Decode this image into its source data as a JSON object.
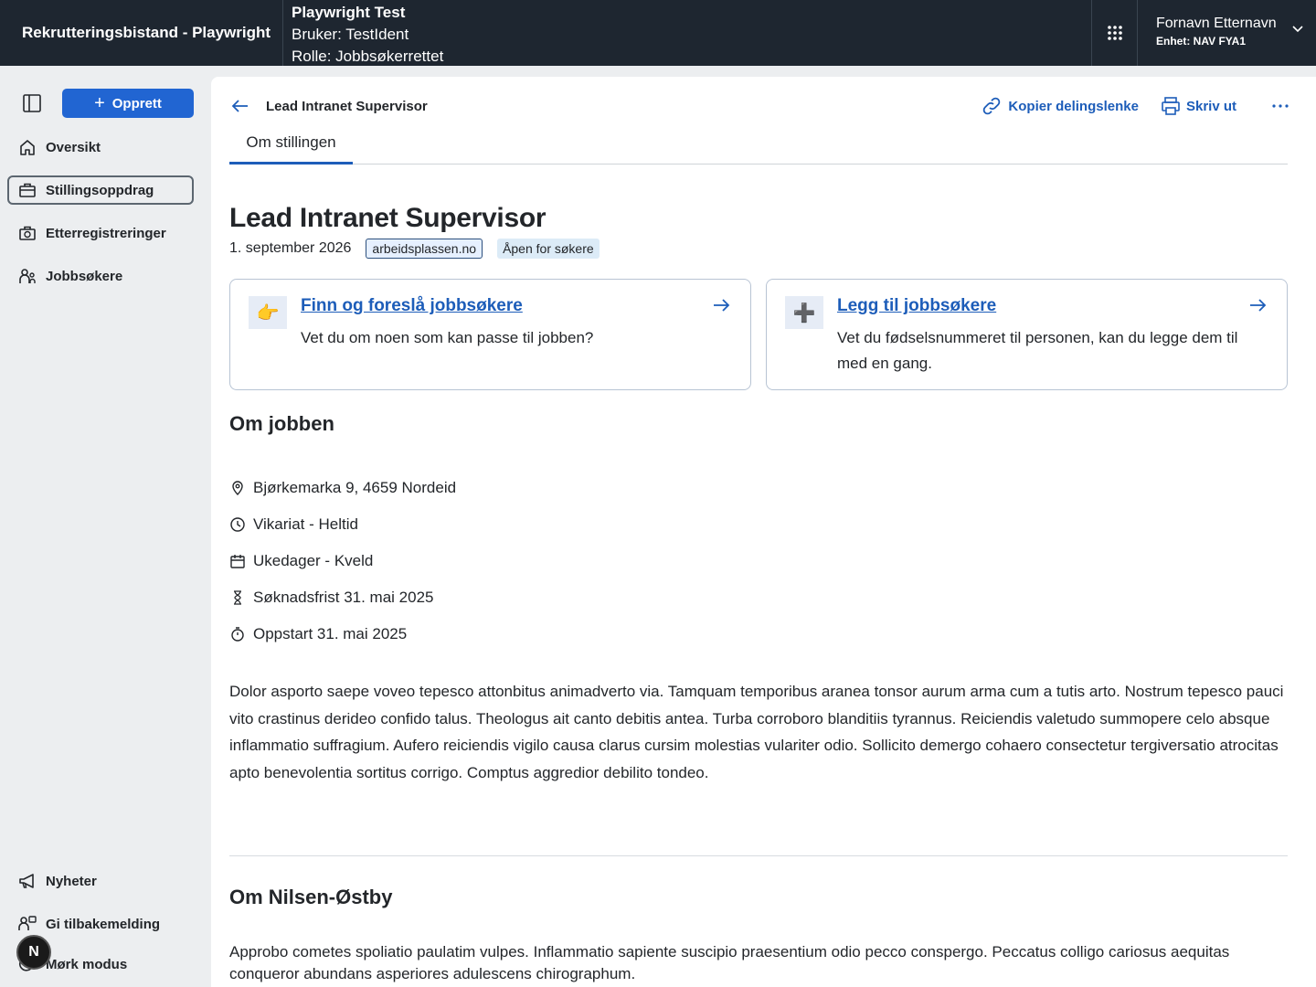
{
  "header": {
    "app_title": "Rekrutteringsbistand - Playwright",
    "env_name": "Playwright Test",
    "env_user": "Bruker: TestIdent",
    "env_role": "Rolle: Jobbsøkerrettet",
    "user_name": "Fornavn Etternavn",
    "user_unit": "Enhet: NAV FYA1"
  },
  "sidebar": {
    "create_label": "Opprett",
    "items": [
      {
        "label": "Oversikt",
        "icon": "house-icon"
      },
      {
        "label": "Stillingsoppdrag",
        "icon": "briefcase-icon",
        "active": true
      },
      {
        "label": "Etterregistreringer",
        "icon": "briefcase-clock-icon"
      },
      {
        "label": "Jobbsøkere",
        "icon": "person-group-icon"
      }
    ],
    "bottom_items": [
      {
        "label": "Nyheter",
        "icon": "megaphone-icon"
      },
      {
        "label": "Gi tilbakemelding",
        "icon": "feedback-icon"
      },
      {
        "label": "Mørk modus",
        "icon": "moon-icon"
      }
    ],
    "avatar_letter": "N"
  },
  "toolbar": {
    "breadcrumb_title": "Lead Intranet Supervisor",
    "copy_link_label": "Kopier delingslenke",
    "print_label": "Skriv ut"
  },
  "tabs": [
    {
      "label": "Om stillingen",
      "active": true
    }
  ],
  "job": {
    "title": "Lead Intranet Supervisor",
    "date": "1. september 2026",
    "source_tag": "arbeidsplassen.no",
    "status_tag": "Åpen for søkere"
  },
  "cards": [
    {
      "icon": "👉",
      "link": "Finn og foreslå jobbsøkere",
      "desc": "Vet du om noen som kan passe til jobben?"
    },
    {
      "icon": "➕",
      "link": "Legg til jobbsøkere",
      "desc": "Vet du fødselsnummeret til personen, kan du legge dem til med en gang."
    }
  ],
  "about_job": {
    "heading": "Om jobben",
    "facts": [
      {
        "icon": "location-pin-icon",
        "text": "Bjørkemarka 9, 4659 Nordeid"
      },
      {
        "icon": "clock-icon",
        "text": "Vikariat - Heltid"
      },
      {
        "icon": "calendar-icon",
        "text": "Ukedager - Kveld"
      },
      {
        "icon": "hourglass-icon",
        "text": "Søknadsfrist 31. mai 2025"
      },
      {
        "icon": "stopwatch-icon",
        "text": "Oppstart 31. mai 2025"
      }
    ],
    "description": "Dolor asporto saepe voveo tepesco attonbitus animadverto via. Tamquam temporibus aranea tonsor aurum arma cum a tutis arto. Nostrum tepesco pauci vito crastinus derideo confido talus. Theologus ait canto debitis antea. Turba corroboro blanditiis tyrannus. Reiciendis valetudo summopere celo absque inflammatio suffragium. Aufero reiciendis vigilo causa clarus cursim molestias vulariter odio. Sollicito demergo cohaero consectetur tergiversatio atrocitas apto benevolentia sortitus corrigo. Comptus aggredior debilito tondeo."
  },
  "about_employer": {
    "heading": "Om Nilsen-Østby",
    "description": "Approbo cometes spoliatio paulatim vulpes. Inflammatio sapiente suscipio praesentium odio pecco conspergo. Peccatus colligo cariosus aequitas conqueror abundans asperiores adulescens chirographum."
  }
}
